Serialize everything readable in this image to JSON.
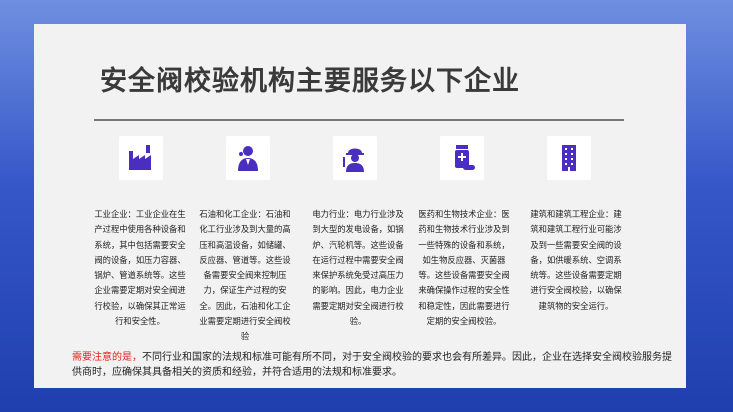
{
  "title": "安全阀校验机构主要服务以下企业",
  "industries": [
    {
      "icon": "factory-icon",
      "text": "工业企业：工业企业在生产过程中使用各种设备和系统，其中包括需要安全阀的设备，如压力容器、锅炉、管道系统等。这些企业需要定期对安全阀进行校验，以确保其正常运行和安全性。"
    },
    {
      "icon": "scientist-icon",
      "text": "石油和化工企业：石油和化工行业涉及到大量的高压和高温设备，如储罐、反应器、管道等。这些设备需要安全阀来控制压力，保证生产过程的安全。因此，石油和化工企业需要定期进行安全阀校验"
    },
    {
      "icon": "worker-icon",
      "text": "电力行业：电力行业涉及到大型的发电设备，如锅炉、汽轮机等。这些设备在运行过程中需要安全阀来保护系统免受过高压力的影响。因此，电力企业需要定期对安全阀进行校验。"
    },
    {
      "icon": "medicine-icon",
      "text": "医药和生物技术企业：医药和生物技术行业涉及到一些特殊的设备和系统，如生物反应器、灭菌器等。这些设备需要安全阀来确保操作过程的安全性和稳定性，因此需要进行定期的安全阀校验。"
    },
    {
      "icon": "building-icon",
      "text": "建筑和建筑工程企业：建筑和建筑工程行业可能涉及到一些需要安全阀的设备，如供暖系统、空调系统等。这些设备需要定期进行安全阀校验，以确保建筑物的安全运行。"
    }
  ],
  "note": {
    "highlight": "需要注意的是，",
    "text": "不同行业和国家的法规和标准可能有所不同，对于安全阀校验的要求也会有所差异。因此，企业在选择安全阀校验服务提供商时，应确保其具备相关的资质和经验，并符合适用的法规和标准要求。"
  },
  "colors": {
    "icon": "#4a2ec0",
    "highlight": "#e4231c",
    "title": "#3a3a3a"
  }
}
